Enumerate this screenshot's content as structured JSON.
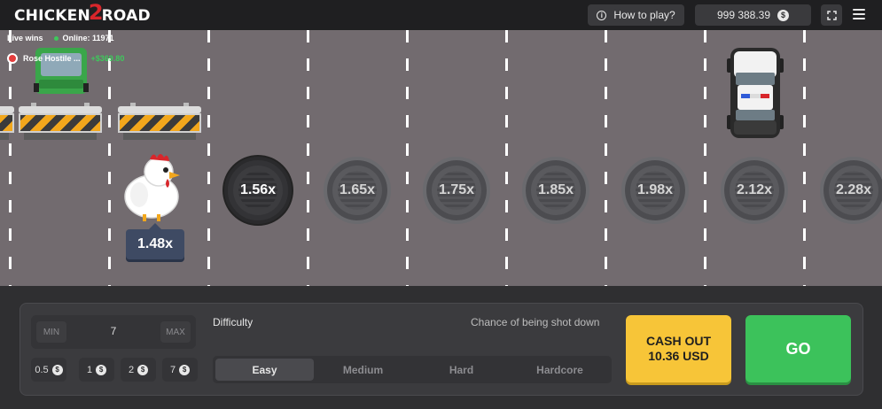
{
  "header": {
    "logo_left": "CHICKEN",
    "logo_num": "2",
    "logo_right": "ROAD",
    "how_to_play": "How to play?",
    "balance": "999 388.39",
    "currency_icon": "$"
  },
  "live": {
    "label": "Live wins",
    "online": "Online: 11971",
    "winner_name": "Rose Hostile ...",
    "winner_amount": "+$369.80"
  },
  "road": {
    "current_multiplier": "1.48x",
    "multipliers": [
      "1.56x",
      "1.65x",
      "1.75x",
      "1.85x",
      "1.98x",
      "2.12x",
      "2.28x"
    ],
    "active_index": 0
  },
  "bet": {
    "min_label": "MIN",
    "max_label": "MAX",
    "value": "7",
    "chips": [
      "0.5",
      "1",
      "2",
      "7"
    ]
  },
  "difficulty": {
    "label": "Difficulty",
    "chance_label": "Chance of being shot down",
    "options": [
      "Easy",
      "Medium",
      "Hard",
      "Hardcore"
    ],
    "selected": "Easy"
  },
  "actions": {
    "cashout_line1": "CASH OUT",
    "cashout_line2": "10.36 USD",
    "go": "GO"
  },
  "colors": {
    "road": "#726b6f",
    "cashout": "#f7c538",
    "go": "#3cc25b",
    "header": "#1f1f21"
  }
}
